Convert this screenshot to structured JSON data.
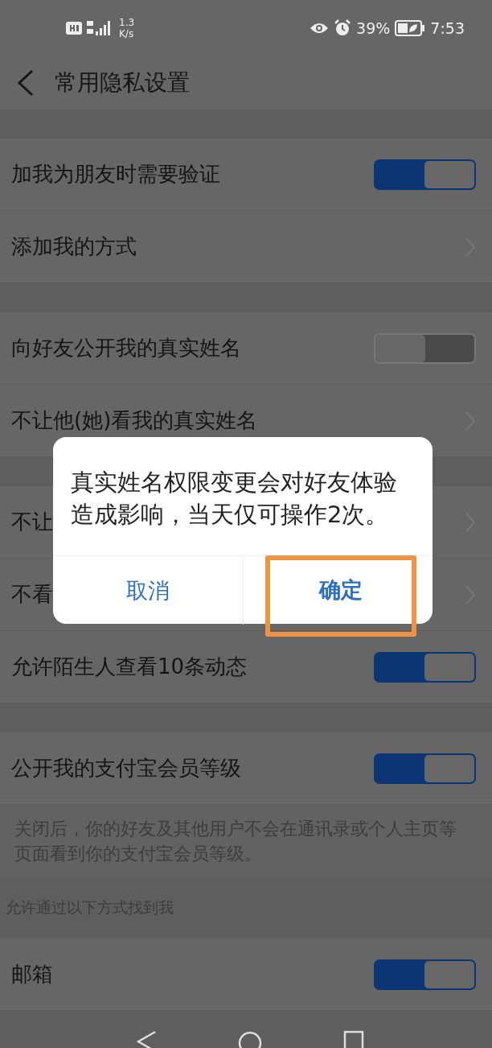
{
  "status_bar": {
    "speed_value": "1.3",
    "speed_unit": "K/s",
    "battery": "39%",
    "time": "7:53"
  },
  "header": {
    "title": "常用隐私设置"
  },
  "sections": [
    {
      "items": [
        {
          "kind": "toggle",
          "label": "加我为朋友时需要验证",
          "on": true
        },
        {
          "kind": "link",
          "label": "添加我的方式"
        }
      ]
    },
    {
      "items": [
        {
          "kind": "toggle",
          "label": "向好友公开我的真实姓名",
          "on": false
        },
        {
          "kind": "link",
          "label": "不让他(她)看我的真实姓名"
        }
      ]
    },
    {
      "items": [
        {
          "kind": "link",
          "label": "不让"
        },
        {
          "kind": "link",
          "label": "不看"
        },
        {
          "kind": "toggle",
          "label": "允许陌生人查看10条动态",
          "on": true
        }
      ]
    },
    {
      "items": [
        {
          "kind": "toggle",
          "label": "公开我的支付宝会员等级",
          "on": true
        }
      ],
      "note": "关闭后，你的好友及其他用户不会在通讯录或个人主页等页面看到你的支付宝会员等级。"
    },
    {
      "header": "允许通过以下方式找到我",
      "items": [
        {
          "kind": "toggle",
          "label": "邮箱",
          "on": true
        }
      ]
    }
  ],
  "dialog": {
    "message": "真实姓名权限变更会对好友体验造成影响，当天仅可操作2次。",
    "buttons": [
      {
        "label": "取消",
        "highlighted": false
      },
      {
        "label": "确定",
        "highlighted": true
      }
    ]
  }
}
